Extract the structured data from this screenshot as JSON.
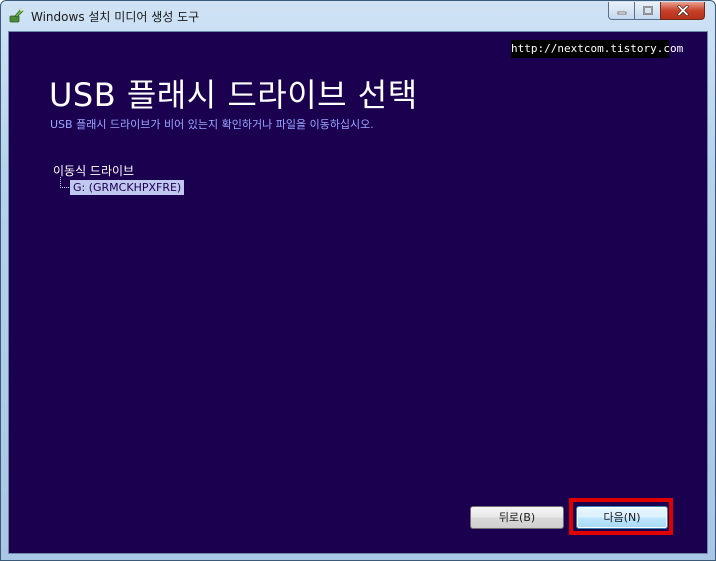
{
  "window": {
    "title": "Windows 설치 미디어 생성 도구"
  },
  "watermark": "http://nextcom.tistory.com",
  "page": {
    "heading": "USB 플래시 드라이브 선택",
    "subheading": "USB 플래시 드라이브가 비어 있는지 확인하거나 파일을 이동하십시오."
  },
  "tree": {
    "root_label": "이동식 드라이브",
    "items": [
      {
        "label": "G: (GRMCKHPXFRE)"
      }
    ]
  },
  "buttons": {
    "back_label": "뒤로(B)",
    "next_label": "다음(N)"
  },
  "colors": {
    "background": "#1b0050",
    "highlight": "#e00000",
    "subheading": "#9aa7ff"
  },
  "icons": {
    "app": "media-creation-tool-icon",
    "minimize": "minimize-icon",
    "maximize": "maximize-icon",
    "close": "close-icon"
  }
}
